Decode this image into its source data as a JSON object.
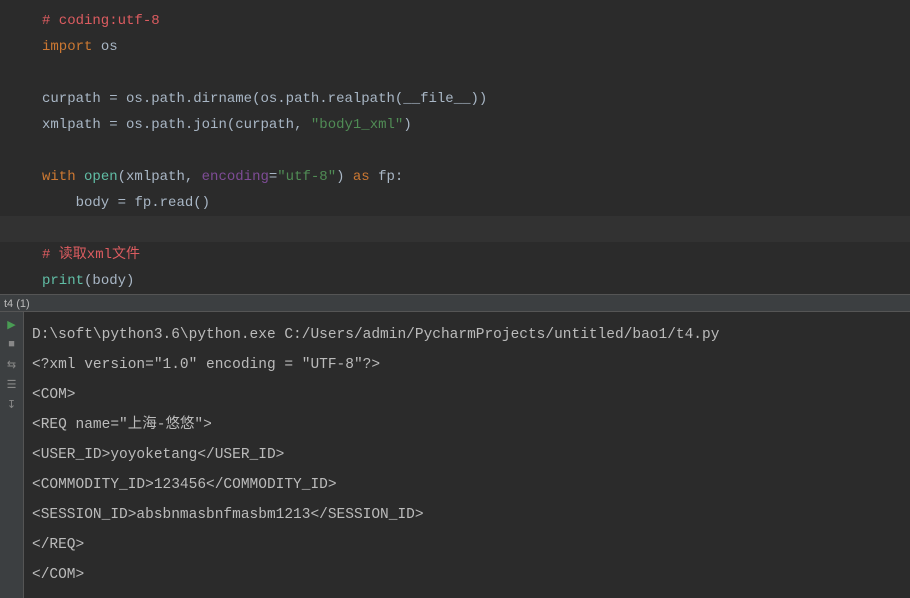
{
  "editor": {
    "lines": [
      {
        "tokens": [
          {
            "c": "comment",
            "t": "# coding:utf-8"
          }
        ]
      },
      {
        "tokens": [
          {
            "c": "keyword",
            "t": "import "
          },
          {
            "c": "module",
            "t": "os"
          }
        ]
      },
      {
        "tokens": []
      },
      {
        "tokens": [
          {
            "c": "identifier",
            "t": "curpath "
          },
          {
            "c": "op",
            "t": "= "
          },
          {
            "c": "identifier",
            "t": "os.path.dirname"
          },
          {
            "c": "paren",
            "t": "("
          },
          {
            "c": "identifier",
            "t": "os.path.realpath"
          },
          {
            "c": "paren",
            "t": "("
          },
          {
            "c": "identifier",
            "t": "__file__"
          },
          {
            "c": "paren",
            "t": "))"
          }
        ]
      },
      {
        "tokens": [
          {
            "c": "identifier",
            "t": "xmlpath "
          },
          {
            "c": "op",
            "t": "= "
          },
          {
            "c": "identifier",
            "t": "os.path.join"
          },
          {
            "c": "paren",
            "t": "("
          },
          {
            "c": "identifier",
            "t": "curpath"
          },
          {
            "c": "op",
            "t": ", "
          },
          {
            "c": "string",
            "t": "\"body1_xml\""
          },
          {
            "c": "paren",
            "t": ")"
          }
        ]
      },
      {
        "tokens": []
      },
      {
        "tokens": [
          {
            "c": "keyword",
            "t": "with "
          },
          {
            "c": "func",
            "t": "open"
          },
          {
            "c": "paren",
            "t": "("
          },
          {
            "c": "identifier",
            "t": "xmlpath"
          },
          {
            "c": "op",
            "t": ", "
          },
          {
            "c": "param-name",
            "t": "encoding"
          },
          {
            "c": "op",
            "t": "="
          },
          {
            "c": "string",
            "t": "\"utf-8\""
          },
          {
            "c": "paren",
            "t": ") "
          },
          {
            "c": "keyword",
            "t": "as "
          },
          {
            "c": "identifier",
            "t": "fp:"
          }
        ]
      },
      {
        "tokens": [
          {
            "c": "identifier",
            "t": "    body "
          },
          {
            "c": "op",
            "t": "= "
          },
          {
            "c": "identifier",
            "t": "fp.read"
          },
          {
            "c": "paren",
            "t": "()"
          }
        ]
      },
      {
        "highlighted": true,
        "tokens": []
      },
      {
        "tokens": [
          {
            "c": "comment",
            "t": "# 读取xml文件"
          }
        ]
      },
      {
        "tokens": [
          {
            "c": "func",
            "t": "print"
          },
          {
            "c": "paren",
            "t": "("
          },
          {
            "c": "identifier",
            "t": "body"
          },
          {
            "c": "paren",
            "t": ")"
          }
        ]
      }
    ]
  },
  "tab": {
    "label": "t4 (1)"
  },
  "console": {
    "lines": [
      "D:\\soft\\python3.6\\python.exe C:/Users/admin/PycharmProjects/untitled/bao1/t4.py",
      "<?xml version=\"1.0\" encoding = \"UTF-8\"?>",
      "<COM>",
      "<REQ name=\"上海-悠悠\">",
      "<USER_ID>yoyoketang</USER_ID>",
      "<COMMODITY_ID>123456</COMMODITY_ID>",
      "<SESSION_ID>absbnmasbnfmasbm1213</SESSION_ID>",
      "</REQ>",
      "</COM>"
    ]
  },
  "gutter_icons": [
    "rerun",
    "stop",
    "layout",
    "settings",
    "pin"
  ]
}
